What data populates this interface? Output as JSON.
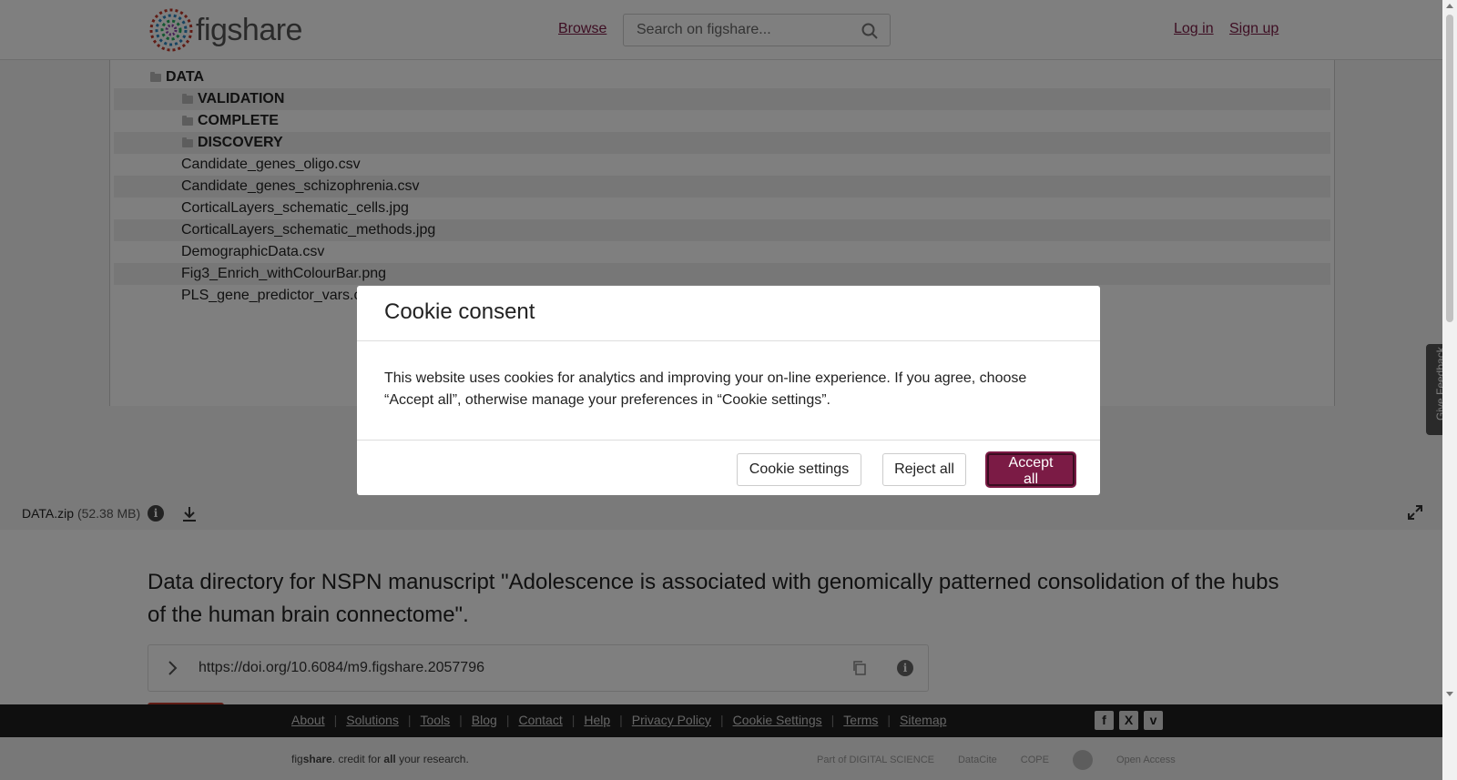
{
  "header": {
    "logo_text": "figshare",
    "browse_label": "Browse",
    "search_placeholder": "Search on figshare...",
    "login_label": "Log in",
    "signup_label": "Sign up"
  },
  "file_tree": {
    "root": "DATA",
    "folders": [
      "VALIDATION",
      "COMPLETE",
      "DISCOVERY"
    ],
    "files": [
      "Candidate_genes_oligo.csv",
      "Candidate_genes_schizophrenia.csv",
      "CorticalLayers_schematic_cells.jpg",
      "CorticalLayers_schematic_methods.jpg",
      "DemographicData.csv",
      "Fig3_Enrich_withColourBar.png",
      "PLS_gene_predictor_vars.c"
    ]
  },
  "file_bar": {
    "file_name": "DATA.zip",
    "file_size": "(52.38 MB)"
  },
  "main": {
    "title": "Data directory for NSPN manuscript \"Adolescence is associated with genomically patterned consolidation of the hubs of the human brain connectome\".",
    "doi": "https://doi.org/10.6084/m9.figshare.2057796"
  },
  "feedback_label": "Give Feedback",
  "footer": {
    "links": [
      "About",
      "Solutions",
      "Tools",
      "Blog",
      "Contact",
      "Help",
      "Privacy Policy",
      "Cookie Settings",
      "Terms",
      "Sitemap"
    ],
    "tagline": {
      "part1": "fig",
      "part2": "share",
      "part3": ". credit for ",
      "part4": "all",
      "part5": " your research."
    },
    "partners": [
      "Part of DIGITAL SCIENCE",
      "DataCite",
      "COPE",
      "",
      "Open Access"
    ]
  },
  "cookie_modal": {
    "title": "Cookie consent",
    "body": "This website uses cookies for analytics and improving your on-line experience. If you agree, choose “Accept all”, otherwise manage your preferences in “Cookie settings”.",
    "settings_label": "Cookie settings",
    "reject_label": "Reject all",
    "accept_label": "Accept all"
  },
  "colors": {
    "brand": "#7b1b45",
    "footer_dark": "#1e1e1e"
  }
}
